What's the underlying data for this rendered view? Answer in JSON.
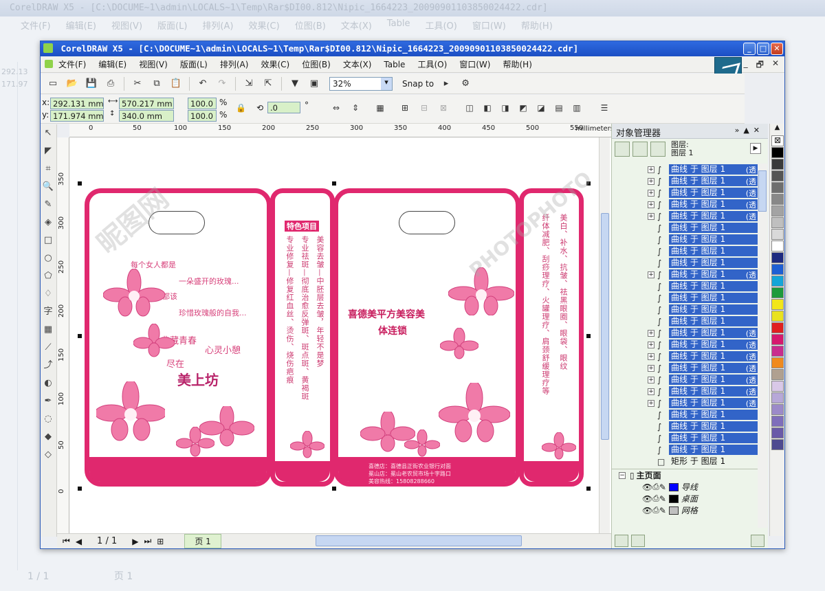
{
  "ghost": {
    "title": "CorelDRAW X5 - [C:\\DOCUME~1\\admin\\LOCALS~1\\Temp\\Rar$DI00.812\\Nipic_1664223_20090901103850024422.cdr]",
    "menu": [
      "文件(F)",
      "编辑(E)",
      "视图(V)",
      "版面(L)",
      "排列(A)",
      "效果(C)",
      "位图(B)",
      "文本(X)",
      "Table",
      "工具(O)",
      "窗口(W)",
      "帮助(H)"
    ],
    "page_label": "1 / 1",
    "page_tab": "页 1",
    "x_val": "292.13",
    "y_val": "171.97"
  },
  "window": {
    "title": "CorelDRAW X5 - [C:\\DOCUME~1\\admin\\LOCALS~1\\Temp\\Rar$DI00.812\\Nipic_1664223_20090901103850024422.cdr]",
    "controls": {
      "min": "_",
      "max": "□",
      "close": "✕"
    }
  },
  "menu": [
    {
      "label": "文件(F)"
    },
    {
      "label": "编辑(E)"
    },
    {
      "label": "视图(V)"
    },
    {
      "label": "版面(L)"
    },
    {
      "label": "排列(A)"
    },
    {
      "label": "效果(C)"
    },
    {
      "label": "位图(B)"
    },
    {
      "label": "文本(X)"
    },
    {
      "label": "Table"
    },
    {
      "label": "工具(O)"
    },
    {
      "label": "窗口(W)"
    },
    {
      "label": "帮助(H)"
    }
  ],
  "doc_controls": {
    "min": "_",
    "restore": "🗗",
    "close": "✕"
  },
  "toolbar": {
    "zoom": "32%",
    "snap_label": "Snap to"
  },
  "propbar": {
    "x": "292.131 mm",
    "y": "171.974 mm",
    "x_label": "x:",
    "y_label": "y:",
    "width": "570.217 mm",
    "height": "340.0 mm",
    "scale_w": "100.0",
    "scale_h": "100.0",
    "pct": "%",
    "rotation": ".0",
    "degree": "°"
  },
  "ruler": {
    "top_ticks": [
      "0",
      "50",
      "100",
      "150",
      "200",
      "250",
      "300",
      "350",
      "400",
      "450",
      "500",
      "550"
    ],
    "left_ticks": [
      "350",
      "300",
      "250",
      "200",
      "150",
      "100",
      "50",
      "0"
    ],
    "unit": "millimeters"
  },
  "status": {
    "page_count": "1 / 1",
    "page_tab": "页 1"
  },
  "object_manager": {
    "title": "对象管理器",
    "layer_line1": "图层:",
    "layer_line2": "图层 1",
    "rows": [
      {
        "text": "曲线 于 图层 1",
        "suffix": "(透",
        "expand": true
      },
      {
        "text": "曲线 于 图层 1",
        "suffix": "(透",
        "expand": true
      },
      {
        "text": "曲线 于 图层 1",
        "suffix": "(透",
        "expand": true
      },
      {
        "text": "曲线 于 图层 1",
        "suffix": "(透",
        "expand": true
      },
      {
        "text": "曲线 于 图层 1",
        "suffix": "(透",
        "expand": true
      },
      {
        "text": "曲线 于 图层 1",
        "suffix": "",
        "expand": false
      },
      {
        "text": "曲线 于 图层 1",
        "suffix": "",
        "expand": false
      },
      {
        "text": "曲线 于 图层 1",
        "suffix": "",
        "expand": false
      },
      {
        "text": "曲线 于 图层 1",
        "suffix": "",
        "expand": false
      },
      {
        "text": "曲线 于 图层 1",
        "suffix": "(透",
        "expand": true
      },
      {
        "text": "曲线 于 图层 1",
        "suffix": "",
        "expand": false
      },
      {
        "text": "曲线 于 图层 1",
        "suffix": "",
        "expand": false
      },
      {
        "text": "曲线 于 图层 1",
        "suffix": "",
        "expand": false
      },
      {
        "text": "曲线 于 图层 1",
        "suffix": "",
        "expand": false
      },
      {
        "text": "曲线 于 图层 1",
        "suffix": "(透",
        "expand": true
      },
      {
        "text": "曲线 于 图层 1",
        "suffix": "(透",
        "expand": true
      },
      {
        "text": "曲线 于 图层 1",
        "suffix": "(透",
        "expand": true
      },
      {
        "text": "曲线 于 图层 1",
        "suffix": "(透",
        "expand": true
      },
      {
        "text": "曲线 于 图层 1",
        "suffix": "(透",
        "expand": true
      },
      {
        "text": "曲线 于 图层 1",
        "suffix": "(透",
        "expand": true
      },
      {
        "text": "曲线 于 图层 1",
        "suffix": "(透",
        "expand": true
      },
      {
        "text": "曲线 于 图层 1",
        "suffix": "",
        "expand": false
      },
      {
        "text": "曲线 于 图层 1",
        "suffix": "",
        "expand": false
      },
      {
        "text": "曲线 于 图层 1",
        "suffix": "",
        "expand": false
      },
      {
        "text": "曲线 于 图层 1",
        "suffix": "",
        "expand": false
      },
      {
        "text": "矩形 于 图层 1",
        "suffix": "",
        "expand": false
      }
    ],
    "master_page": "主页面",
    "master_layers": [
      {
        "name": "导线",
        "color": "#0000ff"
      },
      {
        "name": "桌面",
        "color": "#000000"
      },
      {
        "name": "网格",
        "color": "#c0c0c0"
      }
    ]
  },
  "palette": [
    "#000000",
    "#3a3a3a",
    "#555555",
    "#6e6e6e",
    "#888888",
    "#a3a3a3",
    "#bfbfbf",
    "#d9d9d9",
    "#ffffff",
    "#1d2a80",
    "#1e5fd4",
    "#14a5d8",
    "#1c9a3c",
    "#f2e61a",
    "#e9e21f",
    "#e02020",
    "#d6196e",
    "#c92c8e",
    "#f08a1e",
    "#b0a090",
    "#d9c8e8",
    "#b7a8d8",
    "#9c8ac9",
    "#7f6ebb",
    "#6a5aa8",
    "#4f4a90"
  ],
  "artwork": {
    "poem_lines": [
      "每个女人都是",
      "一朵盛开的玫瑰...",
      "每个女人都该",
      "珍惜玫瑰般的自我..."
    ],
    "left_phrases": {
      "a": "典藏青春",
      "b": "心灵小憩",
      "c": "尽在"
    },
    "logo_text": "美上坊",
    "center_title_line1": "喜德美平方美容美",
    "center_title_line2": "体连锁",
    "narrow_left_col1": "美容去皱—中胚层去皱，年轻不是梦",
    "narrow_left_col2": "专业祛斑—彻底治愈反弹斑、斑点斑、黄褐斑",
    "narrow_left_col3": "专业修复—修复红血丝、烫伤、烧伤疤痕",
    "narrow_left_header": "特色项目",
    "narrow_right_col1": "美白、补水、抗皱、祛黑眼圈、眼袋、眼纹",
    "narrow_right_col2": "纤体减肥、刮痧理疗、火罐理疗、肩颈舒缓理疗等",
    "addr_line1": "喜德店：喜德县正街农业银行对面",
    "addr_line2": "冕山店：冕山老农贸市场十字路口",
    "addr_line3": "美容热线：15808288660",
    "watermark1": "昵图网",
    "watermark2": "PHOTOPHOTO"
  }
}
